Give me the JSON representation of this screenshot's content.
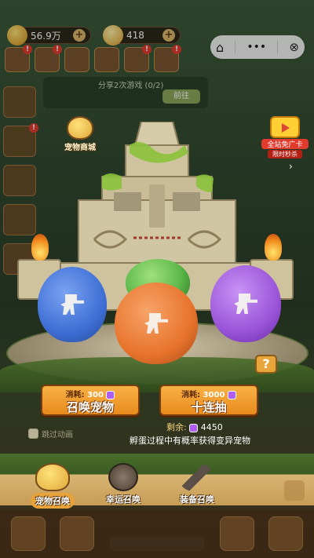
{
  "topbar": {
    "resource1_value": "56.9万",
    "resource2_value": "418"
  },
  "share": {
    "text": "分享2次游戏 (0/2)",
    "button_label": "前往"
  },
  "pet_shop": {
    "label": "宠物商城"
  },
  "promo": {
    "title": "全站免广卡",
    "subtitle": "限时秒杀"
  },
  "summon": {
    "single": {
      "cost_label": "消耗:",
      "cost_value": "300",
      "label": "召唤宠物"
    },
    "ten": {
      "cost_label": "消耗:",
      "cost_value": "3000",
      "label": "十连抽"
    },
    "remaining_label": "剩余:",
    "remaining_value": "4450",
    "tip": "孵蛋过程中有概率获得变异宠物",
    "skip_label": "跳过动画"
  },
  "tabs": [
    {
      "label": "宠物召唤",
      "active": true
    },
    {
      "label": "幸运召唤",
      "active": false
    },
    {
      "label": "装备召唤",
      "active": false
    }
  ],
  "colors": {
    "egg_blue": "#3f6fd6",
    "egg_green": "#5cb84a",
    "egg_orange": "#e8742c",
    "egg_purple": "#9a55d8",
    "button_orange": "#f5a43a"
  }
}
